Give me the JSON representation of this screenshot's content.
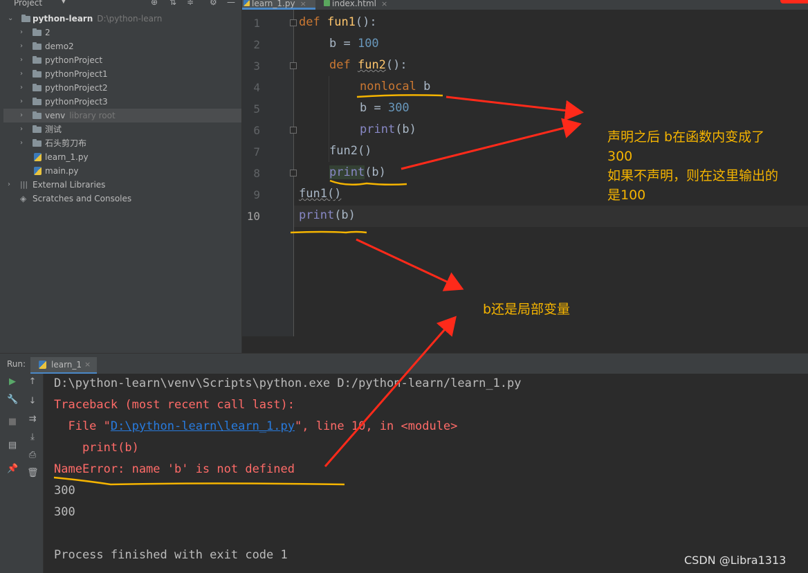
{
  "project": {
    "title": "Project",
    "root_name": "python-learn",
    "root_path": "D:\\python-learn",
    "items": [
      {
        "label": "2",
        "type": "folder"
      },
      {
        "label": "demo2",
        "type": "folder"
      },
      {
        "label": "pythonProject",
        "type": "folder"
      },
      {
        "label": "pythonProject1",
        "type": "folder"
      },
      {
        "label": "pythonProject2",
        "type": "folder"
      },
      {
        "label": "pythonProject3",
        "type": "folder"
      },
      {
        "label": "venv",
        "hint": "library root",
        "type": "folder"
      },
      {
        "label": "测试",
        "type": "folder"
      },
      {
        "label": "石头剪刀布",
        "type": "folder"
      },
      {
        "label": "learn_1.py",
        "type": "py"
      },
      {
        "label": "main.py",
        "type": "py"
      }
    ],
    "external_libraries": "External Libraries",
    "scratches": "Scratches and Consoles"
  },
  "tabs": [
    {
      "label": "learn_1.py",
      "active": true
    },
    {
      "label": "index.html",
      "active": false
    }
  ],
  "editor": {
    "line_numbers": [
      "1",
      "2",
      "3",
      "4",
      "5",
      "6",
      "7",
      "8",
      "9",
      "10"
    ],
    "current_line": "10",
    "code": {
      "l1_kw": "def",
      "l1_name": "fun1",
      "l1_rest": "():",
      "l2_var": "b = ",
      "l2_num": "100",
      "l3_kw": "def",
      "l3_name": "fun2",
      "l3_rest": "():",
      "l4_kw": "nonlocal",
      "l4_rest": " b",
      "l5_var": "b = ",
      "l5_num": "300",
      "l6_fn": "print",
      "l6_rest": "(b)",
      "l7": "fun2()",
      "l8_fn": "print",
      "l8_rest": "(b)",
      "l9": "fun1()",
      "l10_fn": "print",
      "l10_rest": "(b)"
    }
  },
  "run": {
    "label": "Run:",
    "tab_label": "learn_1",
    "console": {
      "cmd": "D:\\python-learn\\venv\\Scripts\\python.exe D:/python-learn/learn_1.py",
      "tb_head": "Traceback (most recent call last):",
      "file_pre": "  File \"",
      "file_link": "D:\\python-learn\\learn_1.py",
      "file_post": "\", line 10, in <module>",
      "code_line": "    print(b)",
      "error": "NameError: name 'b' is not defined",
      "out1": "300",
      "out2": "300",
      "finished": "Process finished with exit code 1"
    }
  },
  "annotations": {
    "note1_line1": "声明之后 b在函数内变成了",
    "note1_line2": "300",
    "note1_line3": "如果不声明，则在这里输出的",
    "note1_line4": "是100",
    "note2": "b还是局部变量",
    "color_text": "#f5b400",
    "color_arrow": "#ff2a1a",
    "color_underline": "#f5b400"
  },
  "watermark": "CSDN @Libra1313"
}
